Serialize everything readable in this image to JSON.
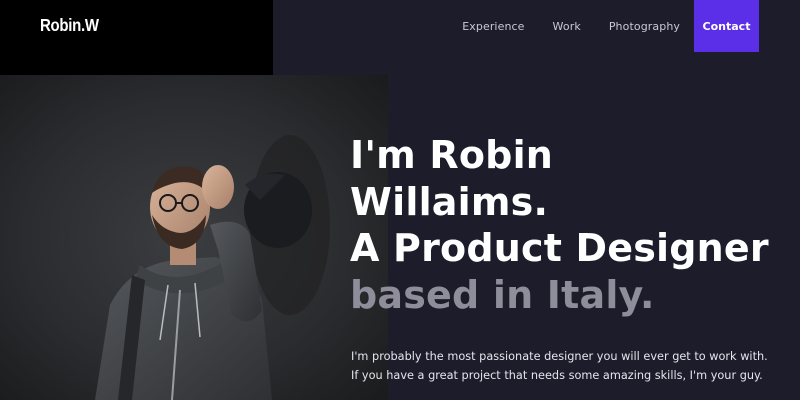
{
  "brand": {
    "logo_text": "Robin.W"
  },
  "nav": {
    "items": [
      {
        "label": "Experience"
      },
      {
        "label": "Work"
      },
      {
        "label": "Photography"
      }
    ],
    "contact_label": "Contact"
  },
  "hero": {
    "line1": "I'm Robin",
    "line2": "Willaims.",
    "line3": "A Product Designer",
    "line4": "based in Italy."
  },
  "intro": {
    "text": "I'm probably the most passionate designer you will ever get to work with. If you have a great project that needs some amazing skills, I'm your guy."
  },
  "colors": {
    "background": "#1d1c2a",
    "logo_block": "#000000",
    "accent": "#5b2fe8",
    "muted_text": "#8e8d99"
  }
}
